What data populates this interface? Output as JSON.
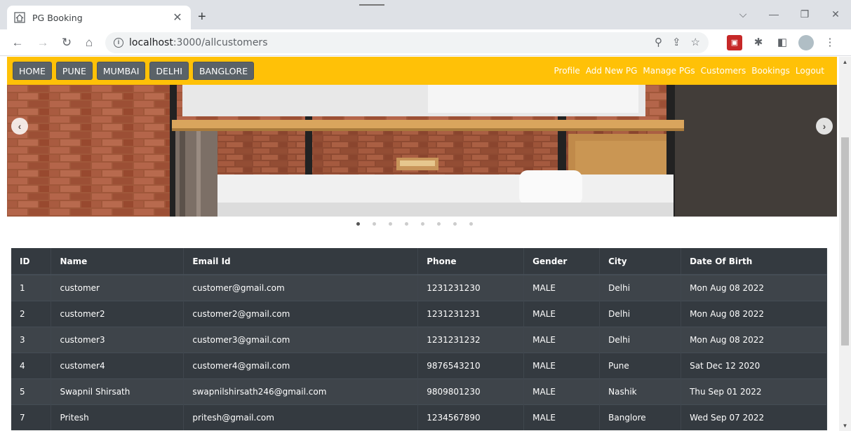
{
  "browser": {
    "tab_title": "PG Booking",
    "url_host": "localhost",
    "url_path": ":3000/allcustomers"
  },
  "navbar": {
    "cities": [
      "HOME",
      "PUNE",
      "MUMBAI",
      "DELHI",
      "BANGLORE"
    ],
    "links": [
      "Profile",
      "Add New PG",
      "Manage PGs",
      "Customers",
      "Bookings",
      "Logout"
    ],
    "accent_color": "#ffc107"
  },
  "carousel": {
    "slide_count": 8,
    "active_index": 0
  },
  "table": {
    "headers": [
      "ID",
      "Name",
      "Email Id",
      "Phone",
      "Gender",
      "City",
      "Date Of Birth"
    ],
    "rows": [
      [
        "1",
        "customer",
        "customer@gmail.com",
        "1231231230",
        "MALE",
        "Delhi",
        "Mon Aug 08 2022"
      ],
      [
        "2",
        "customer2",
        "customer2@gmail.com",
        "1231231231",
        "MALE",
        "Delhi",
        "Mon Aug 08 2022"
      ],
      [
        "3",
        "customer3",
        "customer3@gmail.com",
        "1231231232",
        "MALE",
        "Delhi",
        "Mon Aug 08 2022"
      ],
      [
        "4",
        "customer4",
        "customer4@gmail.com",
        "9876543210",
        "MALE",
        "Pune",
        "Sat Dec 12 2020"
      ],
      [
        "5",
        "Swapnil Shirsath",
        "swapnilshirsath246@gmail.com",
        "9809801230",
        "MALE",
        "Nashik",
        "Thu Sep 01 2022"
      ],
      [
        "7",
        "Pritesh",
        "pritesh@gmail.com",
        "1234567890",
        "MALE",
        "Banglore",
        "Wed Sep 07 2022"
      ]
    ]
  }
}
